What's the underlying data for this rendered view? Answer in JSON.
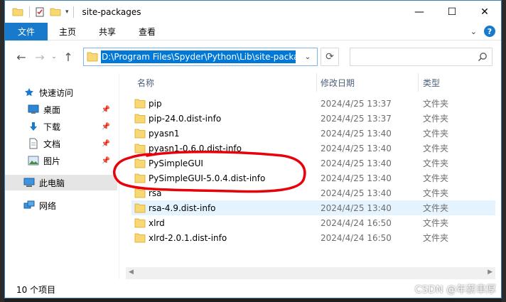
{
  "window": {
    "title": "site-packages",
    "controls": {
      "minimize": "—",
      "maximize": "☐",
      "close": "✕"
    }
  },
  "ribbon": {
    "tabs": [
      "文件",
      "主页",
      "共享",
      "查看"
    ],
    "help": "?"
  },
  "address": {
    "path": "D:\\Program Files\\Spyder\\Python\\Lib\\site-packa",
    "search_placeholder": ""
  },
  "nav": {
    "items": [
      {
        "label": "快速访问",
        "icon": "star-icon",
        "pinned": false
      },
      {
        "label": "桌面",
        "icon": "desktop-icon",
        "pinned": true
      },
      {
        "label": "下载",
        "icon": "download-icon",
        "pinned": true
      },
      {
        "label": "文档",
        "icon": "document-icon",
        "pinned": true
      },
      {
        "label": "图片",
        "icon": "picture-icon",
        "pinned": true
      },
      {
        "label": "此电脑",
        "icon": "computer-icon",
        "pinned": false
      },
      {
        "label": "网络",
        "icon": "network-icon",
        "pinned": false
      }
    ]
  },
  "columns": {
    "name": "名称",
    "date": "修改日期",
    "type": "类型"
  },
  "files": [
    {
      "name": "pip",
      "date": "2024/4/25 13:37",
      "type": "文件夹"
    },
    {
      "name": "pip-24.0.dist-info",
      "date": "2024/4/25 13:37",
      "type": "文件夹"
    },
    {
      "name": "pyasn1",
      "date": "2024/4/25 13:40",
      "type": "文件夹"
    },
    {
      "name": "pyasn1-0.6.0.dist-info",
      "date": "2024/4/25 13:40",
      "type": "文件夹"
    },
    {
      "name": "PySimpleGUI",
      "date": "2024/4/25 13:40",
      "type": "文件夹"
    },
    {
      "name": "PySimpleGUI-5.0.4.dist-info",
      "date": "2024/4/25 13:40",
      "type": "文件夹"
    },
    {
      "name": "rsa",
      "date": "2024/4/25 13:40",
      "type": "文件夹"
    },
    {
      "name": "rsa-4.9.dist-info",
      "date": "2024/4/25 13:40",
      "type": "文件夹"
    },
    {
      "name": "xlrd",
      "date": "2024/4/24 16:50",
      "type": "文件夹"
    },
    {
      "name": "xlrd-2.0.1.dist-info",
      "date": "2024/4/24 16:50",
      "type": "文件夹"
    }
  ],
  "status": {
    "count": "10 个项目"
  },
  "watermark": "CSDN @年薪聿厚",
  "colors": {
    "accent": "#1979ca",
    "selection": "#0078d7",
    "folder": "#f8d775",
    "annotation": "#e8000b"
  }
}
